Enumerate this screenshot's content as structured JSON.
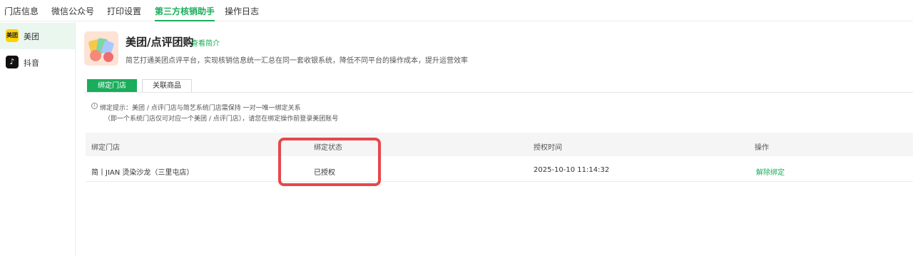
{
  "top_tabs": [
    {
      "label": "门店信息",
      "active": false
    },
    {
      "label": "微信公众号",
      "active": false
    },
    {
      "label": "打印设置",
      "active": false
    },
    {
      "label": "第三方核销助手",
      "active": true
    },
    {
      "label": "操作日志",
      "active": false
    }
  ],
  "sidebar": {
    "items": [
      {
        "label": "美团",
        "icon": "meituan-icon",
        "icon_text": "美团",
        "active": true
      },
      {
        "label": "抖音",
        "icon": "douyin-icon",
        "icon_text": "♪",
        "active": false
      }
    ]
  },
  "header": {
    "title": "美团/点评团购",
    "intro_link": "查看简介",
    "description": "简艺打通美团点评平台，实现核销信息统一汇总在同一套收银系统，降低不同平台的操作成本，提升运营效率"
  },
  "sub_tabs": [
    {
      "label": "绑定门店",
      "active": true
    },
    {
      "label": "关联商品",
      "active": false
    }
  ],
  "hint": {
    "line1": "绑定提示：美团 / 点评门店与简艺系统门店需保持 一对一唯一绑定关系",
    "line2": "（即一个系统门店仅可对应一个美团 / 点评门店），请您在绑定操作前登录美团账号"
  },
  "table": {
    "columns": [
      "绑定门店",
      "绑定状态",
      "授权时间",
      "操作"
    ],
    "rows": [
      {
        "store": "简丨JIAN 烫染沙龙（三里屯店）",
        "status": "已授权",
        "auth_time": "2025-10-10 11:14:32",
        "action": "解除绑定"
      }
    ]
  },
  "colors": {
    "accent": "#1aad5b",
    "highlight": "#e5484d",
    "meituan_yellow": "#ffd100"
  }
}
